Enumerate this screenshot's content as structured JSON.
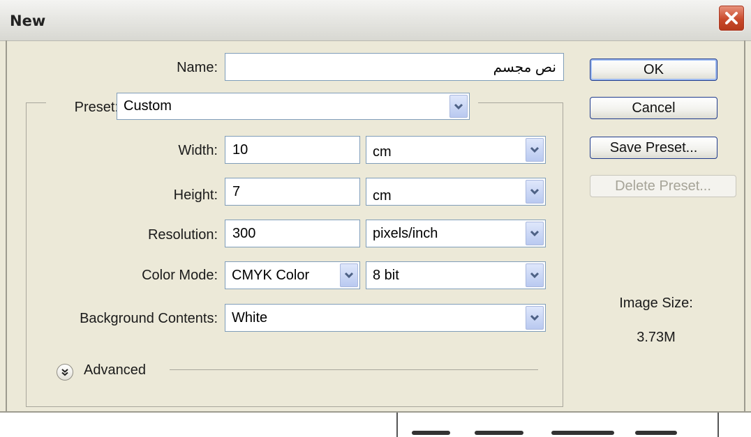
{
  "window": {
    "title": "New"
  },
  "form": {
    "name_label": "Name:",
    "name_value": "نص مجسم",
    "preset_label": "Preset:",
    "preset_value": "Custom",
    "width_label": "Width:",
    "width_value": "10",
    "width_unit": "cm",
    "height_label": "Height:",
    "height_value": "7",
    "height_unit": "cm",
    "resolution_label": "Resolution:",
    "resolution_value": "300",
    "resolution_unit": "pixels/inch",
    "color_mode_label": "Color Mode:",
    "color_mode_value": "CMYK Color",
    "bit_depth_value": "8 bit",
    "background_label": "Background Contents:",
    "background_value": "White",
    "advanced_label": "Advanced"
  },
  "buttons": {
    "ok": "OK",
    "cancel": "Cancel",
    "save_preset": "Save Preset...",
    "delete_preset": "Delete Preset..."
  },
  "info": {
    "image_size_label": "Image Size:",
    "image_size_value": "3.73M"
  },
  "icons": {
    "close": "close-icon",
    "dropdown": "chevron-down-icon",
    "advanced": "double-chevron-down-icon"
  },
  "colors": {
    "dialog_bg": "#ece9d8",
    "close_button": "#c94a2b",
    "field_border": "#7f9db9",
    "button_border": "#1f3a8c"
  }
}
